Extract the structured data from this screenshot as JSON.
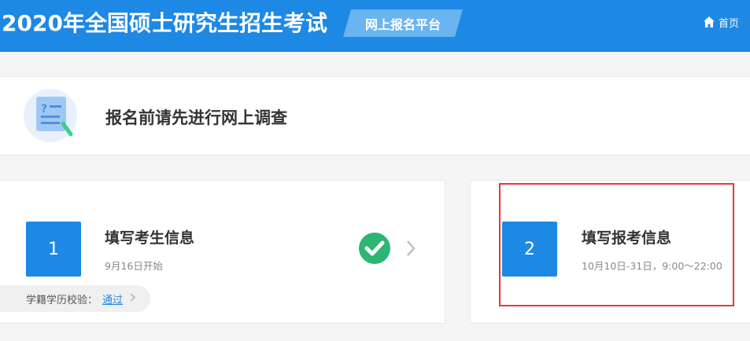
{
  "header": {
    "site_title": "2020年全国硕士研究生招生考试",
    "platform_label": "网上报名平台",
    "home_label": "首页"
  },
  "survey": {
    "title": "报名前请先进行网上调查"
  },
  "steps": [
    {
      "number": "1",
      "title": "填写考生信息",
      "subtitle": "9月16日开始",
      "status": "completed",
      "verify_label": "学籍学历校验：",
      "verify_status": "通过"
    },
    {
      "number": "2",
      "title": "填写报考信息",
      "subtitle": "10月10日-31日，9:00～22:00",
      "highlighted": true
    }
  ],
  "colors": {
    "primary": "#1e88e5",
    "badge": "#6ab4f0",
    "success": "#2bb673",
    "highlight": "#e53935",
    "link": "#1e88e5"
  },
  "icons": {
    "home": "home-icon",
    "survey": "survey-document-icon",
    "check": "check-circle-icon",
    "chevron": "chevron-right-icon"
  }
}
